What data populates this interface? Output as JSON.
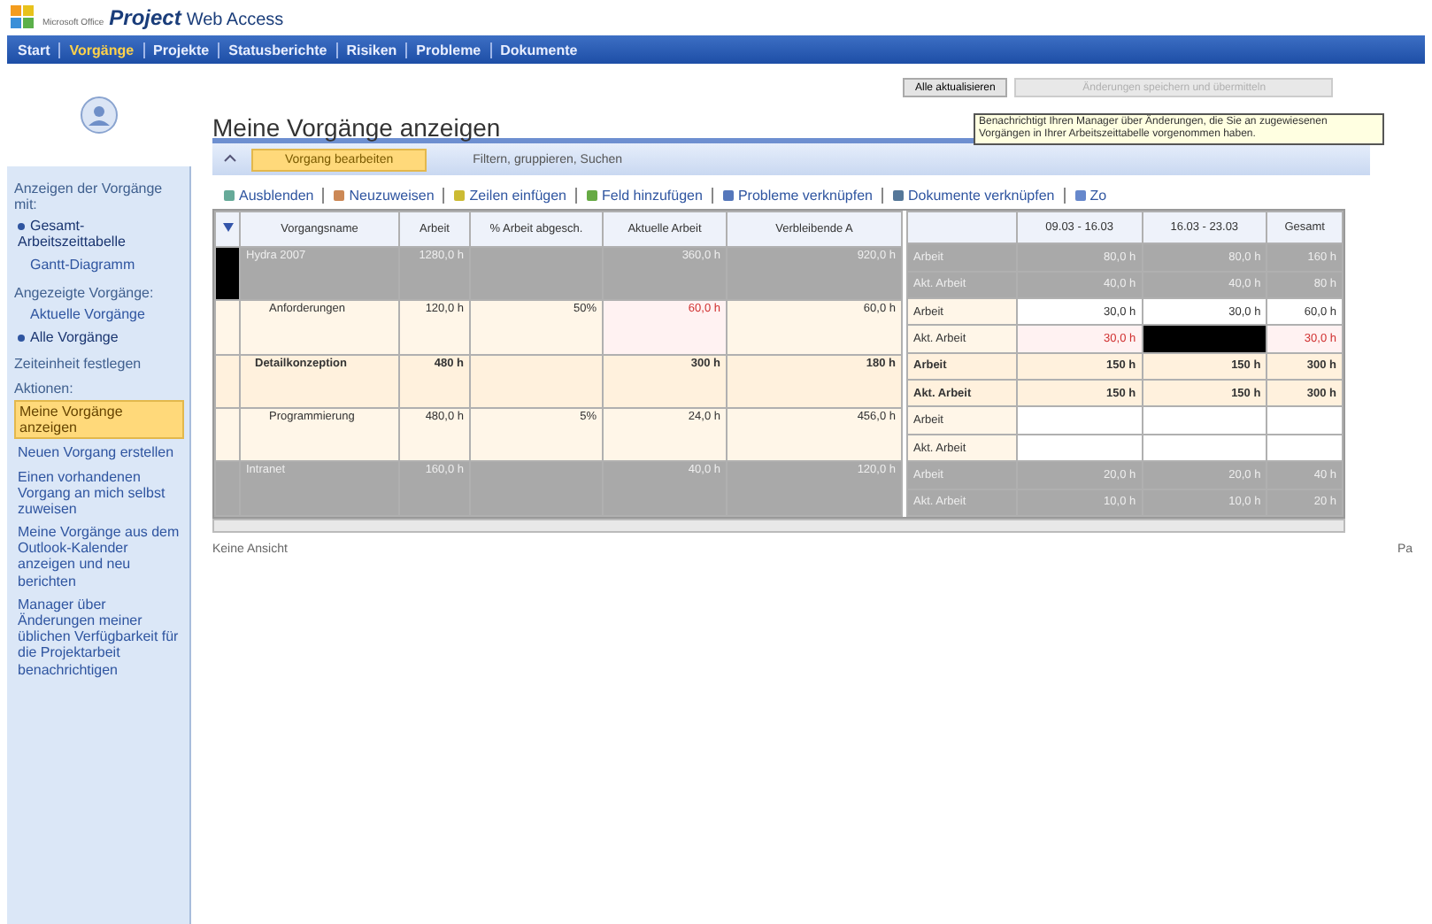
{
  "app": {
    "brand_small": "Microsoft Office",
    "brand": "Project",
    "product": "Web Access"
  },
  "nav": [
    {
      "label": "Start",
      "selected": false
    },
    {
      "label": "Vorgänge",
      "selected": true
    },
    {
      "label": "Projekte",
      "selected": false
    },
    {
      "label": "Statusberichte",
      "selected": false
    },
    {
      "label": "Risiken",
      "selected": false
    },
    {
      "label": "Probleme",
      "selected": false
    },
    {
      "label": "Dokumente",
      "selected": false
    }
  ],
  "sidebar": {
    "sections": [
      {
        "title": "Anzeigen der Vorgänge mit:",
        "items": [
          {
            "label": "Gesamt-Arbeitszeittabelle",
            "selected": true
          },
          {
            "label": "Gantt-Diagramm",
            "selected": false
          }
        ]
      },
      {
        "title": "Angezeigte Vorgänge:",
        "items": [
          {
            "label": "Aktuelle Vorgänge",
            "selected": false
          },
          {
            "label": "Alle Vorgänge",
            "selected": true
          }
        ]
      },
      {
        "title": "Zeiteinheit festlegen"
      },
      {
        "title": "Aktionen:",
        "items": [
          {
            "label": "Meine Vorgänge anzeigen",
            "selected": true
          },
          {
            "label": "Neuen Vorgang erstellen",
            "selected": false
          },
          {
            "label": "Einen vorhandenen Vorgang an mich selbst zuweisen",
            "selected": false
          },
          {
            "label": "Meine Vorgänge aus dem Outlook-Kalender anzeigen und neu berichten",
            "selected": false
          },
          {
            "label": "Manager über Änderungen meiner üblichen Verfügbarkeit für die Projektarbeit benachrichtigen",
            "selected": false
          }
        ]
      }
    ]
  },
  "page_title": "Meine Vorgänge anzeigen",
  "actions": [
    {
      "label": "Alle aktualisieren",
      "disabled": false
    },
    {
      "label": "Änderungen speichern und übermitteln",
      "disabled": true
    }
  ],
  "tooltip": "Benachrichtigt Ihren Manager über Änderungen, die Sie an zugewiesenen Vorgängen in Ihrer Arbeitszeittabelle vorgenommen haben.",
  "tabs": [
    {
      "label": "Vorgang bearbeiten",
      "selected": true
    },
    {
      "label": "Filtern, gruppieren, Suchen",
      "selected": false
    }
  ],
  "toolbar": [
    "Ausblenden",
    "Neuzuweisen",
    "Zeilen einfügen",
    "Feld hinzufügen",
    "Probleme verknüpfen",
    "Dokumente verknüpfen",
    "Zo"
  ],
  "left_grid": {
    "columns": [
      "Vorgangsname",
      "Arbeit",
      "% Arbeit abgesch.",
      "Aktuelle Arbeit",
      "Verbleibende A"
    ],
    "rows": [
      {
        "kind": "group",
        "selected": true,
        "cells": [
          {
            "text": "Hydra 2007",
            "warn": false
          },
          {
            "text": "1280,0 h",
            "warn": false
          },
          {
            "text": "",
            "warn": false
          },
          {
            "text": "360,0 h",
            "warn": false
          },
          {
            "text": "920,0 h",
            "warn": false
          }
        ]
      },
      {
        "kind": "task",
        "selected": false,
        "cells": [
          {
            "text": "Anforderungen",
            "warn": false
          },
          {
            "text": "120,0 h",
            "warn": false
          },
          {
            "text": "50%",
            "warn": false
          },
          {
            "text": "60,0 h",
            "warn": true
          },
          {
            "text": "60,0 h",
            "warn": false
          }
        ]
      },
      {
        "kind": "summary",
        "selected": false,
        "cells": [
          {
            "text": "Detailkonzeption",
            "warn": false
          },
          {
            "text": "480 h",
            "warn": false
          },
          {
            "text": "",
            "warn": false
          },
          {
            "text": "300 h",
            "warn": false
          },
          {
            "text": "180 h",
            "warn": false
          }
        ]
      },
      {
        "kind": "task",
        "selected": false,
        "cells": [
          {
            "text": "Programmierung",
            "warn": false
          },
          {
            "text": "480,0 h",
            "warn": false
          },
          {
            "text": "5%",
            "warn": false
          },
          {
            "text": "24,0 h",
            "warn": false
          },
          {
            "text": "456,0 h",
            "warn": false
          }
        ]
      },
      {
        "kind": "group",
        "selected": false,
        "cells": [
          {
            "text": "Intranet",
            "warn": false
          },
          {
            "text": "160,0 h",
            "warn": false
          },
          {
            "text": "",
            "warn": false
          },
          {
            "text": "40,0 h",
            "warn": false
          },
          {
            "text": "120,0 h",
            "warn": false
          }
        ]
      }
    ]
  },
  "right_grid": {
    "columns": [
      "09.03 - 16.03",
      "16.03 - 23.03",
      "Gesamt"
    ],
    "rows": [
      {
        "kind": "group",
        "label": "Arbeit",
        "cells": [
          {
            "text": "80,0 h",
            "warn": false,
            "selected": false
          },
          {
            "text": "80,0 h",
            "warn": false,
            "selected": false
          },
          {
            "text": "160 h",
            "warn": false,
            "selected": false
          }
        ]
      },
      {
        "kind": "group",
        "label": "Akt. Arbeit",
        "cells": [
          {
            "text": "40,0 h",
            "warn": false,
            "selected": false
          },
          {
            "text": "40,0 h",
            "warn": false,
            "selected": false
          },
          {
            "text": "80 h",
            "warn": false,
            "selected": false
          }
        ]
      },
      {
        "kind": "task",
        "label": "Arbeit",
        "cells": [
          {
            "text": "30,0 h",
            "warn": false,
            "selected": false
          },
          {
            "text": "30,0 h",
            "warn": false,
            "selected": false
          },
          {
            "text": "60,0 h",
            "warn": false,
            "selected": false
          }
        ]
      },
      {
        "kind": "task",
        "label": "Akt. Arbeit",
        "cells": [
          {
            "text": "30,0 h",
            "warn": true,
            "selected": false
          },
          {
            "text": "",
            "warn": false,
            "selected": true
          },
          {
            "text": "30,0 h",
            "warn": true,
            "selected": false
          }
        ]
      },
      {
        "kind": "summary",
        "label": "Arbeit",
        "cells": [
          {
            "text": "150 h",
            "warn": false,
            "selected": false
          },
          {
            "text": "150 h",
            "warn": false,
            "selected": false
          },
          {
            "text": "300 h",
            "warn": false,
            "selected": false
          }
        ]
      },
      {
        "kind": "summary",
        "label": "Akt. Arbeit",
        "cells": [
          {
            "text": "150 h",
            "warn": false,
            "selected": false
          },
          {
            "text": "150 h",
            "warn": false,
            "selected": false
          },
          {
            "text": "300 h",
            "warn": false,
            "selected": false
          }
        ]
      },
      {
        "kind": "task",
        "label": "Arbeit",
        "cells": [
          {
            "text": "",
            "warn": false,
            "selected": false
          },
          {
            "text": "",
            "warn": false,
            "selected": false
          },
          {
            "text": "",
            "warn": false,
            "selected": false
          }
        ]
      },
      {
        "kind": "task",
        "label": "Akt. Arbeit",
        "cells": [
          {
            "text": "",
            "warn": false,
            "selected": false
          },
          {
            "text": "",
            "warn": false,
            "selected": false
          },
          {
            "text": "",
            "warn": false,
            "selected": false
          }
        ]
      },
      {
        "kind": "group",
        "label": "Arbeit",
        "cells": [
          {
            "text": "20,0 h",
            "warn": false,
            "selected": false
          },
          {
            "text": "20,0 h",
            "warn": false,
            "selected": false
          },
          {
            "text": "40 h",
            "warn": false,
            "selected": false
          }
        ]
      },
      {
        "kind": "group",
        "label": "Akt. Arbeit",
        "cells": [
          {
            "text": "10,0 h",
            "warn": false,
            "selected": false
          },
          {
            "text": "10,0 h",
            "warn": false,
            "selected": false
          },
          {
            "text": "20 h",
            "warn": false,
            "selected": false
          }
        ]
      }
    ]
  },
  "status_left": "Keine Ansicht",
  "status_right": "Pa"
}
